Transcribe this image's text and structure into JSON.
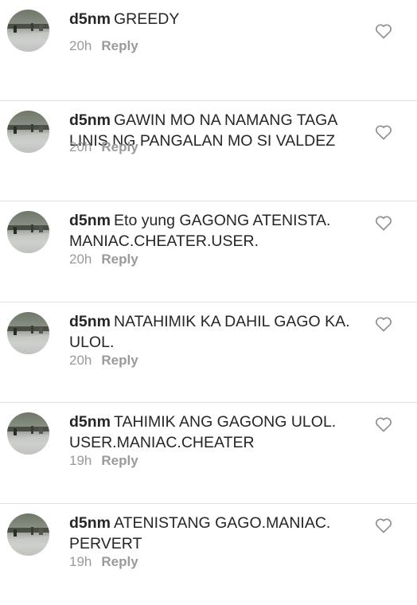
{
  "reply_label": "Reply",
  "comments": [
    {
      "username": "d5nm",
      "lines": [
        "GREEDY"
      ],
      "time": "20h"
    },
    {
      "username": "d5nm",
      "lines": [
        "GAWIN MO NA NAMANG TAGA",
        "LINIS NG PANGALAN MO SI VALDEZ"
      ],
      "time": "20h"
    },
    {
      "username": "d5nm",
      "lines": [
        "Eto yung GAGONG ATENISTA.",
        "MANIAC.CHEATER.USER."
      ],
      "time": "20h"
    },
    {
      "username": "d5nm",
      "lines": [
        "NATAHIMIK KA DAHIL GAGO KA.",
        "ULOL."
      ],
      "time": "20h"
    },
    {
      "username": "d5nm",
      "lines": [
        "TAHIMIK ANG GAGONG ULOL.",
        "USER.MANIAC.CHEATER"
      ],
      "time": "19h"
    },
    {
      "username": "d5nm",
      "lines": [
        "ATENISTANG GAGO.MANIAC.",
        "PERVERT"
      ],
      "time": "19h"
    }
  ],
  "icons": {
    "like": "heart-outline-icon",
    "avatar": "profile-photo-avatar"
  },
  "colors": {
    "text": "#262626",
    "meta": "#9a9a9a",
    "divider": "#e2e2e2"
  }
}
